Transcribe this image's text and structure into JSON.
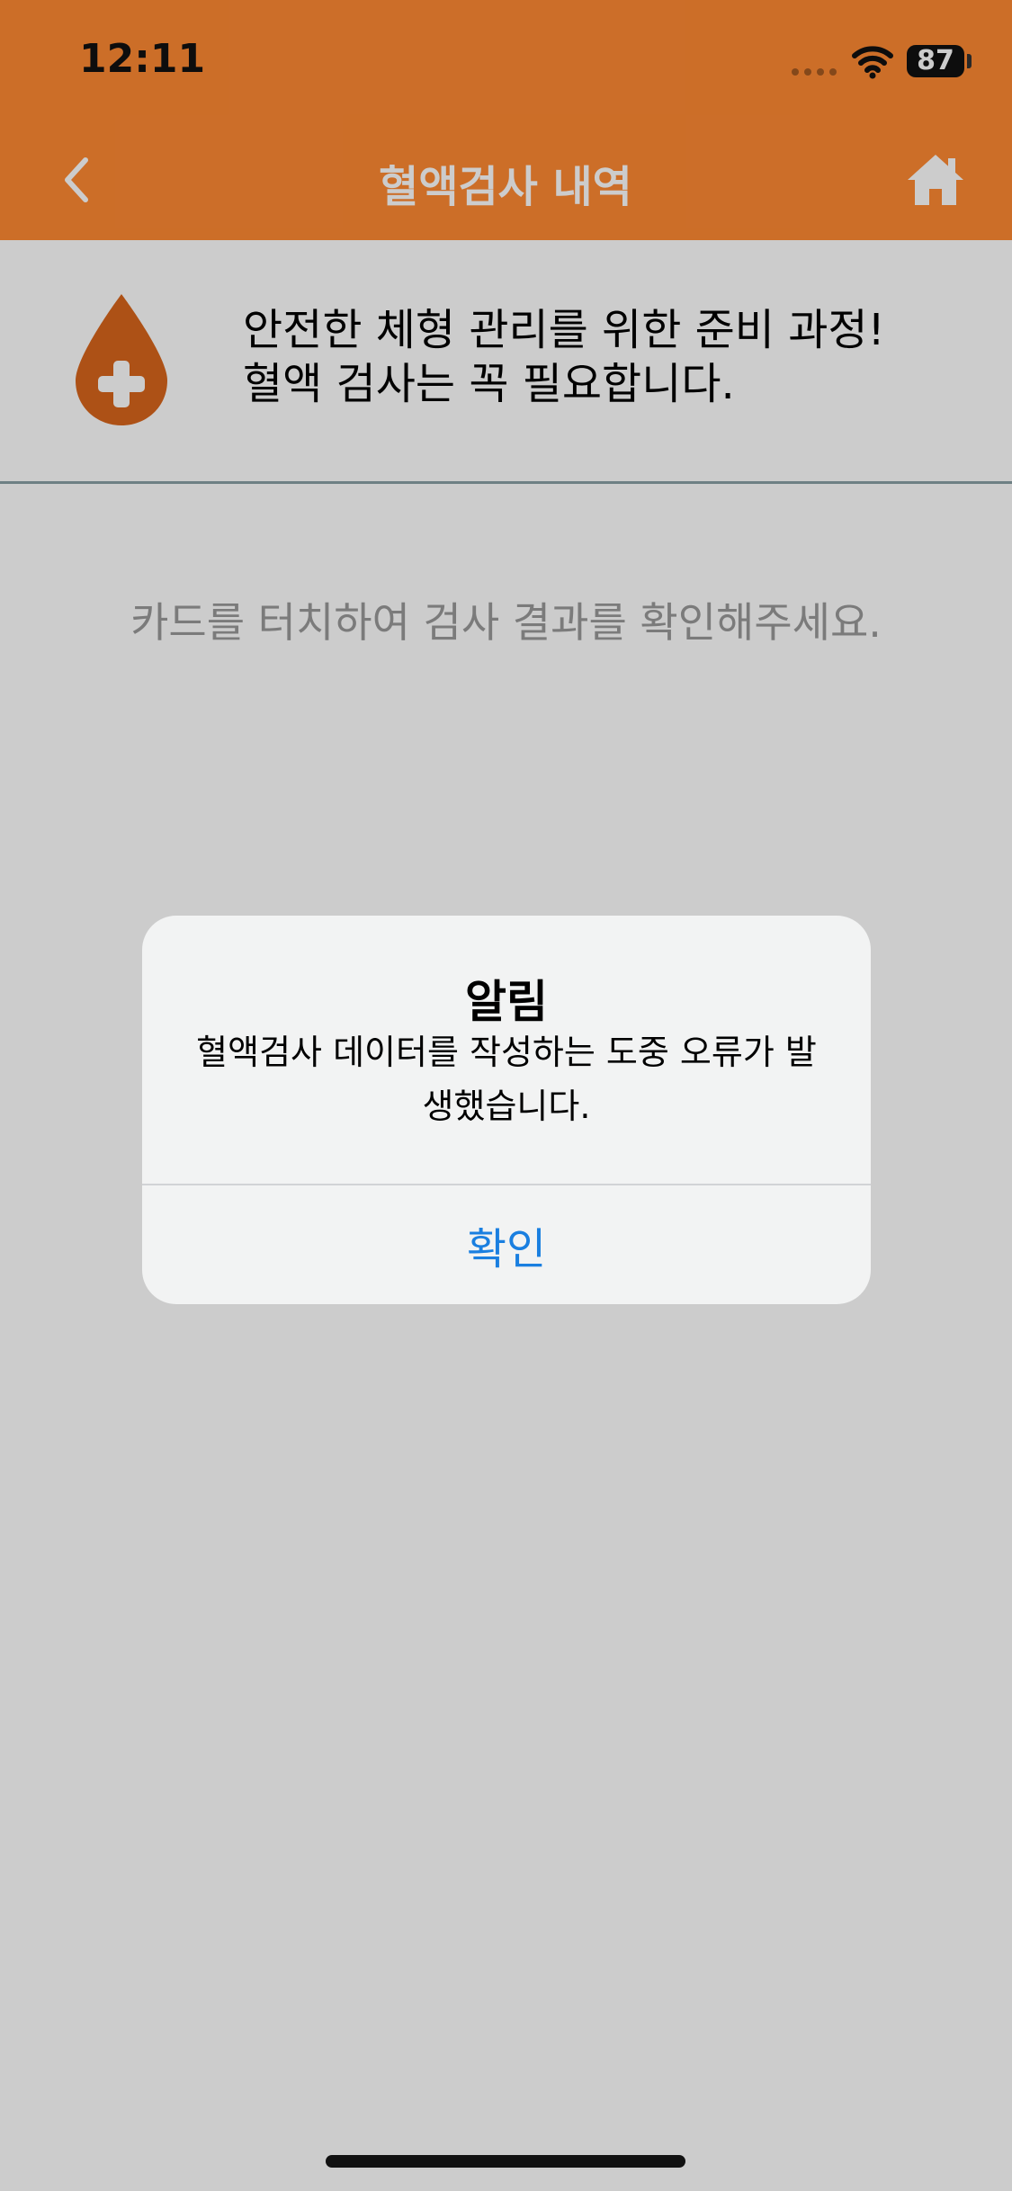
{
  "status_bar": {
    "time": "12:11",
    "battery": "87",
    "icons": [
      "signal-dots-icon",
      "wifi-icon",
      "battery-icon"
    ]
  },
  "nav": {
    "title": "혈액검사 내역",
    "back_icon": "chevron-left-icon",
    "home_icon": "home-icon"
  },
  "banner": {
    "icon": "blood-drop-plus-icon",
    "line1": "안전한 체형 관리를 위한 준비 과정!",
    "line2": "혈액 검사는 꼭 필요합니다."
  },
  "hint": "카드를 터치하여 검사 결과를 확인해주세요.",
  "alert": {
    "title": "알림",
    "message": "혈액검사 데이터를 작성하는 도중 오류가 발생했습니다.",
    "confirm_label": "확인"
  },
  "colors": {
    "header": "#ff8a33",
    "accent": "#d9661c",
    "link": "#1a7fe0"
  }
}
